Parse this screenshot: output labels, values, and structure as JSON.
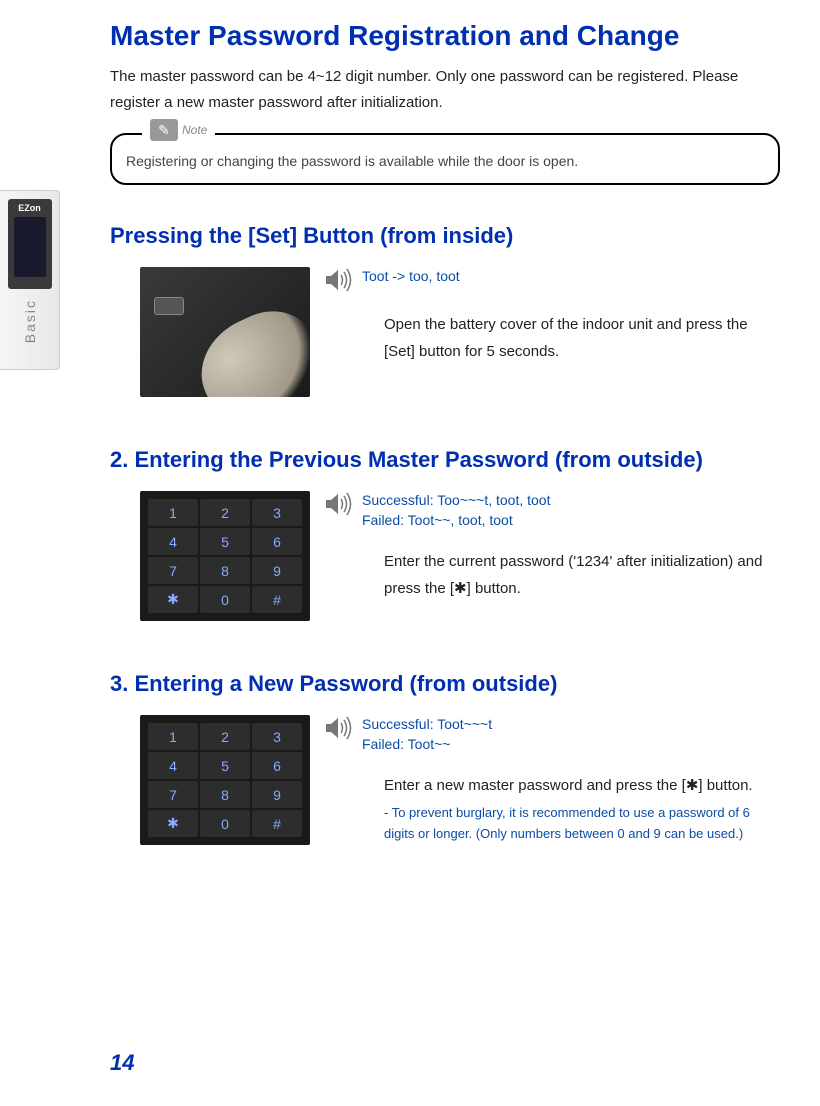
{
  "sideTab": {
    "logo": "EZon",
    "label": "Basic"
  },
  "title": "Master Password Registration and Change",
  "intro": "The master password can be 4~12 digit number. Only one password can be registered. Please register a new master password after initialization.",
  "note": {
    "label": "Note",
    "text": "Registering or changing the password is available while the door is open."
  },
  "section1": {
    "title": "Pressing the [Set] Button (from inside)",
    "sound": "Toot -> too, toot",
    "instruction": "Open the battery cover of the indoor unit and press the [Set] button for 5 seconds."
  },
  "section2": {
    "title": "2. Entering the Previous Master Password (from outside)",
    "soundSuccess": "Successful: Too~~~t, toot, toot",
    "soundFailed": "Failed: Toot~~, toot, toot",
    "instruction": "Enter the current password ('1234' after initialization) and press the [✱] button."
  },
  "section3": {
    "title": "3. Entering a New Password (from outside)",
    "soundSuccess": "Successful: Toot~~~t",
    "soundFailed": "Failed: Toot~~",
    "instruction": "Enter a new master password and press the [✱] button.",
    "tip": "- To prevent burglary, it is recommended to use a password of 6 digits or longer. (Only numbers between 0 and 9 can be used.)"
  },
  "keypad": [
    "1",
    "2",
    "3",
    "4",
    "5",
    "6",
    "7",
    "8",
    "9",
    "✱",
    "0",
    "#"
  ],
  "pageNumber": "14"
}
